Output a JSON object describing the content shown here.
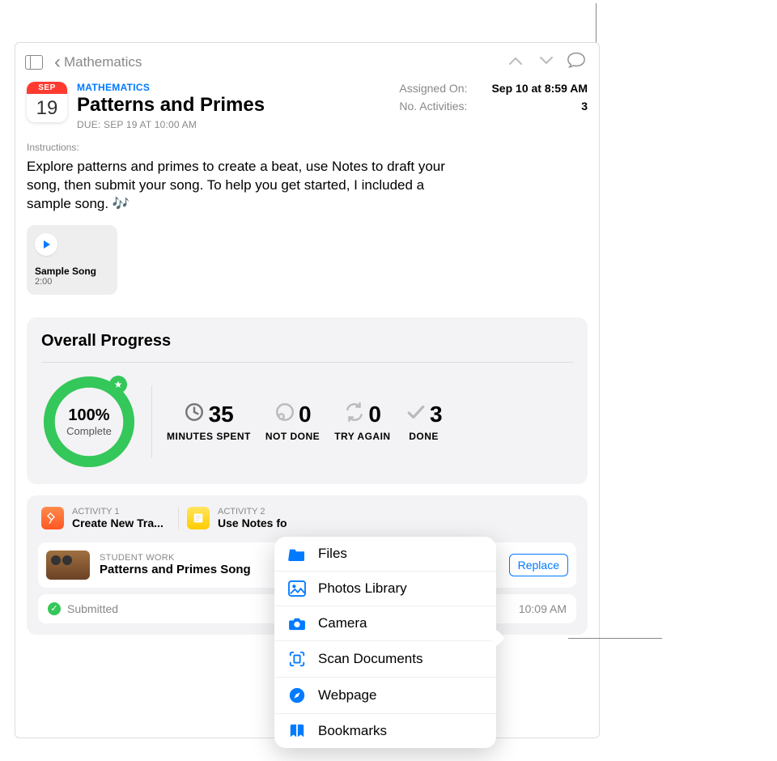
{
  "nav": {
    "back_label": "Mathematics"
  },
  "assignment": {
    "category": "MATHEMATICS",
    "title": "Patterns and Primes",
    "due": "DUE: SEP 19 AT 10:00 AM",
    "calendar": {
      "month": "SEP",
      "day": "19"
    }
  },
  "meta": {
    "assigned_label": "Assigned On:",
    "assigned_value": "Sep 10 at 8:59 AM",
    "activities_label": "No. Activities:",
    "activities_value": "3"
  },
  "instructions": {
    "label": "Instructions:",
    "text": "Explore patterns and primes to create a beat, use Notes to draft your song, then submit your song. To help you get started, I included a sample song. 🎶"
  },
  "attachment": {
    "title": "Sample Song",
    "duration": "2:00"
  },
  "progress": {
    "title": "Overall Progress",
    "percent": "100%",
    "complete_label": "Complete",
    "stats": {
      "minutes_value": "35",
      "minutes_label": "MINUTES SPENT",
      "notdone_value": "0",
      "notdone_label": "NOT DONE",
      "tryagain_value": "0",
      "tryagain_label": "TRY AGAIN",
      "done_value": "3",
      "done_label": "DONE"
    }
  },
  "activities": {
    "a1_sup": "ACTIVITY 1",
    "a1_title": "Create New Tra...",
    "a2_sup": "ACTIVITY 2",
    "a2_title": "Use Notes fo"
  },
  "student_work": {
    "label": "STUDENT WORK",
    "title": "Patterns and Primes Song",
    "replace": "Replace"
  },
  "submitted": {
    "label": "Submitted",
    "time_suffix": "10:09 AM"
  },
  "popover": {
    "files": "Files",
    "photos": "Photos Library",
    "camera": "Camera",
    "scan": "Scan Documents",
    "webpage": "Webpage",
    "bookmarks": "Bookmarks"
  }
}
